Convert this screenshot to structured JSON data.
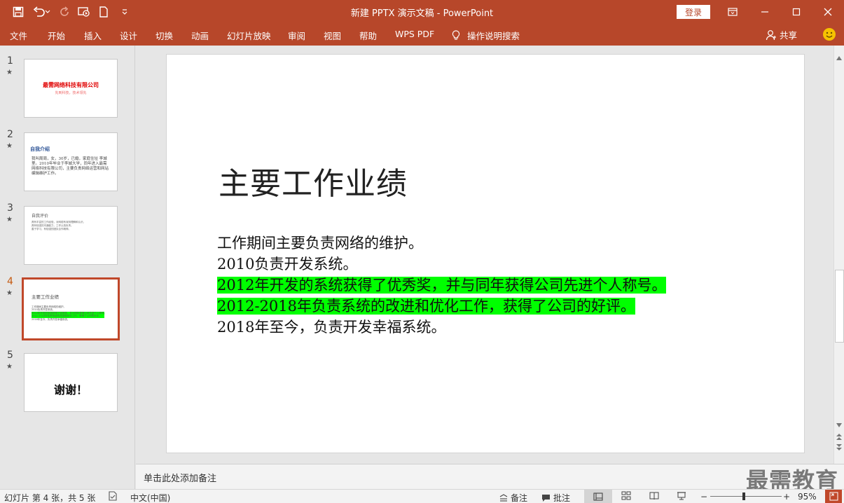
{
  "window": {
    "title": "新建 PPTX 演示文稿  -  PowerPoint",
    "login_label": "登录",
    "accent_color": "#b7472a"
  },
  "quick_access": {
    "icons": [
      "save-icon",
      "undo-icon",
      "redo-icon",
      "present-from-start-icon",
      "new-file-icon",
      "customize-icon"
    ]
  },
  "ribbon": {
    "tabs": [
      "文件",
      "开始",
      "插入",
      "设计",
      "切换",
      "动画",
      "幻灯片放映",
      "审阅",
      "视图",
      "帮助",
      "WPS PDF"
    ],
    "tell_me": "操作说明搜索",
    "share_label": "共享"
  },
  "thumbnails": [
    {
      "number": "1",
      "title": "最需网络科技有限公司",
      "subtitle": "先到科技，技术领先"
    },
    {
      "number": "2",
      "title": "自我介绍",
      "body": "我叫周周，女，30岁，已婚，家庭住址 李城里。2010年毕业于李城大学，同年进入最需网络科技有限公司，主要负责网络运营和网站编辑维护工作。"
    },
    {
      "number": "3",
      "title": "自我评价",
      "lines": [
        "具有丰富的工作经验，对网络有深刻理解和认识。",
        "具有较强的沟通能力，工作认真负责。",
        "善于学习，有较强的团队合作精神。"
      ]
    },
    {
      "number": "4",
      "title": "主要工作业绩"
    },
    {
      "number": "5",
      "title": "谢谢！"
    }
  ],
  "slide": {
    "title": "主要工作业绩",
    "lines": [
      {
        "text": "工作期间主要负责网络的维护。",
        "highlight": false
      },
      {
        "text": "2010负责开发系统。",
        "highlight": false
      },
      {
        "text": "2012年开发的系统获得了优秀奖，并与同年获得公司先进个人称号。",
        "highlight": true
      },
      {
        "text": "2012-2018年负责系统的改进和优化工作，获得了公司的好评。",
        "highlight": true
      },
      {
        "text": "2018年至今，负责开发幸福系统。",
        "highlight": false
      }
    ],
    "highlight_color": "#00ff00"
  },
  "notes": {
    "placeholder": "单击此处添加备注",
    "watermark": "最需教育"
  },
  "statusbar": {
    "slide_info": "幻灯片 第 4 张，共 5 张",
    "language": "中文(中国)",
    "notes_label": "备注",
    "comments_label": "批注",
    "zoom_minus": "−",
    "zoom_plus": "+",
    "zoom": "95%",
    "zoom_fraction": 0.47
  }
}
